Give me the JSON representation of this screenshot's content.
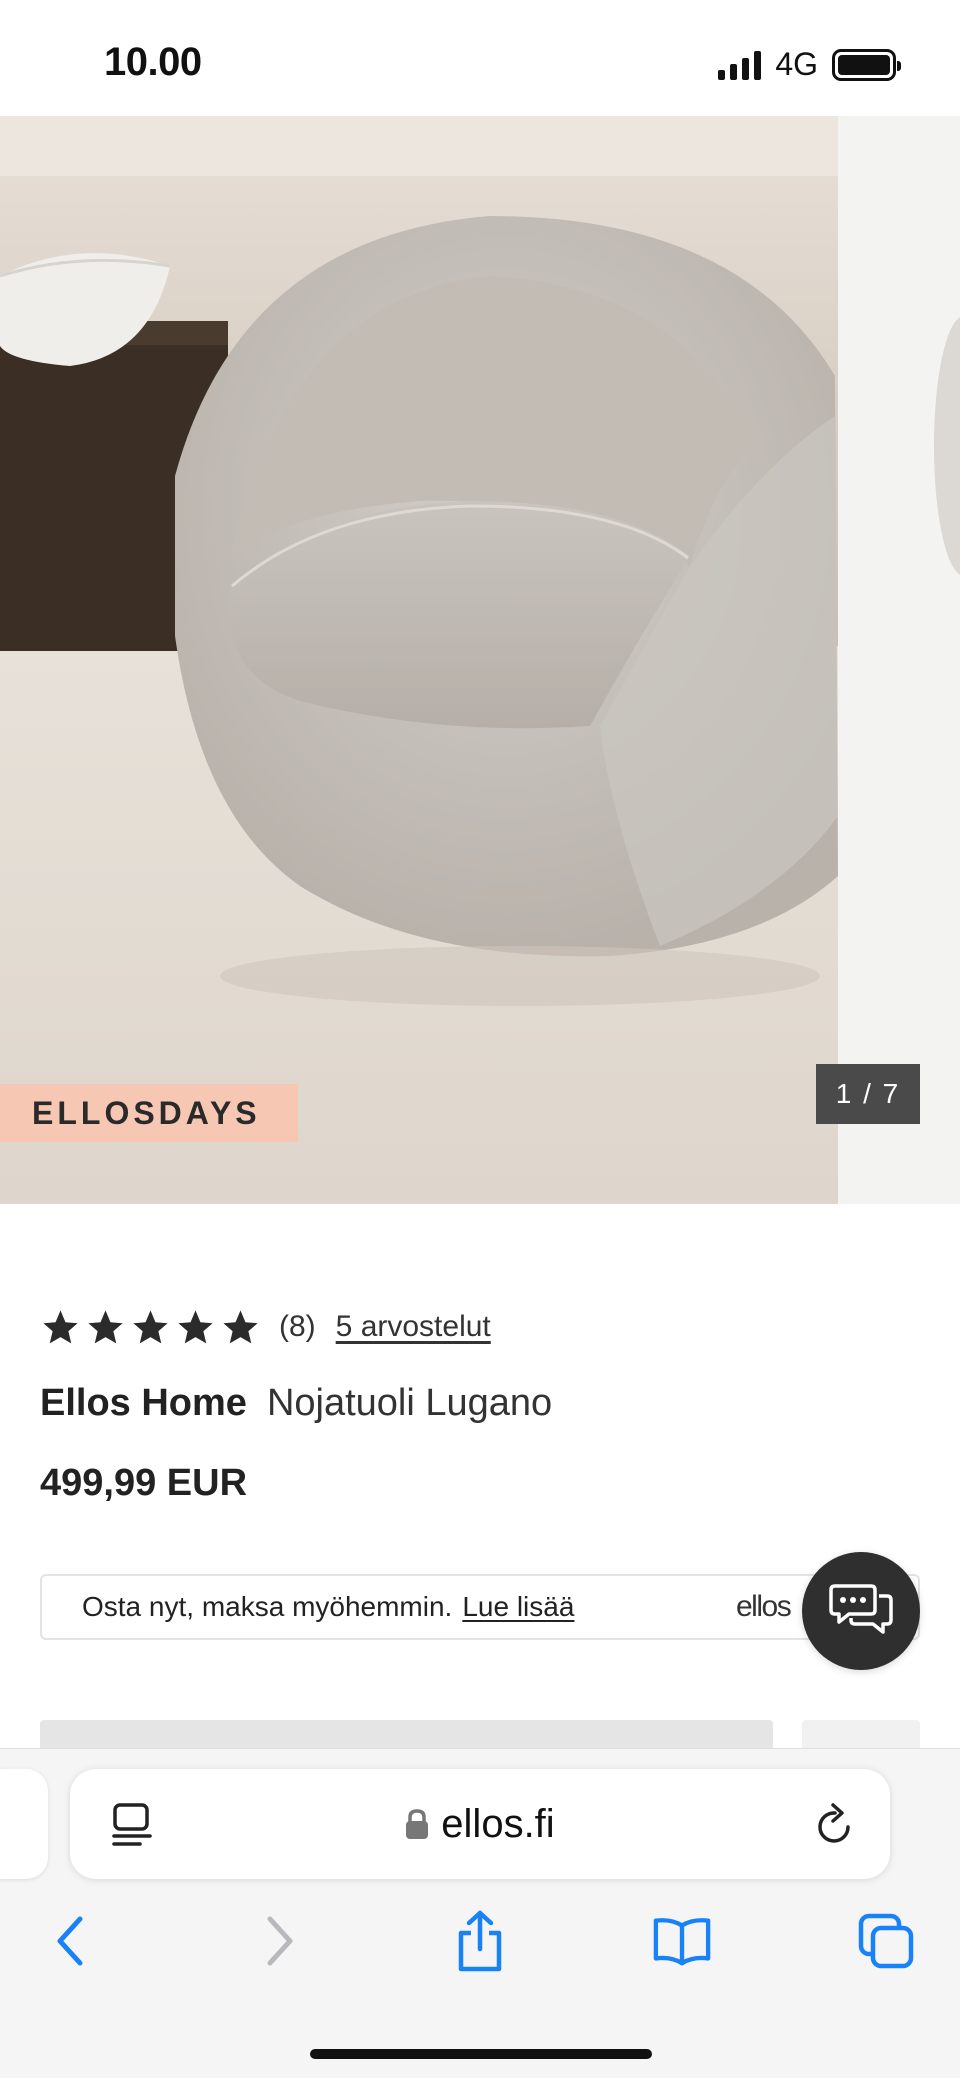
{
  "status_bar": {
    "time": "10.00",
    "network": "4G"
  },
  "gallery": {
    "promo_badge": "ELLOSDAYS",
    "counter": "1 / 7"
  },
  "product": {
    "rating": {
      "stars": 5,
      "count": "(8)",
      "reviews_link": "5 arvostelut"
    },
    "brand": "Ellos Home",
    "name": "Nojatuoli Lugano",
    "price": "499,99 EUR"
  },
  "bnpl": {
    "text": "Osta nyt, maksa myöhemmin.",
    "link": "Lue lisää",
    "logo": "ellos"
  },
  "browser": {
    "url": "ellos.fi"
  },
  "icons": {
    "chat": "chat-bubbles-icon",
    "reader": "reader-mode-icon",
    "lock": "lock-icon",
    "reload": "reload-icon",
    "back": "chevron-left-icon",
    "forward": "chevron-right-icon",
    "share": "share-icon",
    "bookmarks": "book-icon",
    "tabs": "tabs-icon"
  },
  "colors": {
    "accent_ios": "#1a82f7",
    "badge": "#f6c8b4",
    "counter_bg": "#4a4a4a",
    "chat_bg": "#2f2f2f"
  }
}
